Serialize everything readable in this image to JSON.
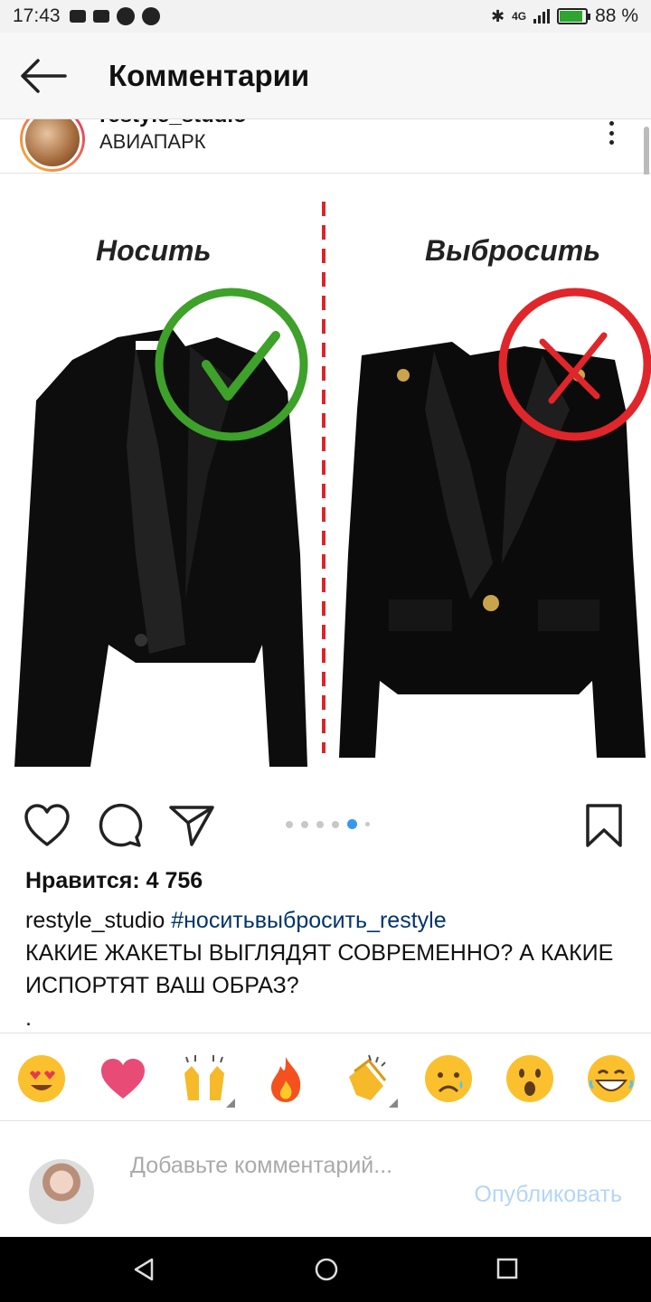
{
  "status_bar": {
    "time": "17:43",
    "network": "4G",
    "battery_percent": 88,
    "battery_label": "88 %"
  },
  "header": {
    "title": "Комментарии",
    "back_icon": "arrow-left-icon"
  },
  "post": {
    "username": "restyle_studio",
    "location": "АВИАПАРК",
    "image": {
      "left_label": "Носить",
      "right_label": "Выбросить"
    },
    "carousel": {
      "total": 6,
      "active_index": 4
    },
    "likes": "Нравится: 4 756",
    "caption_user": "restyle_studio",
    "caption_tag": "#носитьвыбросить_restyle",
    "caption_text": "КАКИЕ ЖАКЕТЫ ВЫГЛЯДЯТ СОВРЕМЕННО? А КАКИЕ ИСПОРТЯТ ВАШ ОБРАЗ?",
    "caption_dot": "."
  },
  "emoji_bar": {
    "items": [
      "heart-eyes",
      "heart",
      "raised-hands",
      "fire",
      "clapping-hands",
      "crying-face",
      "surprised-face",
      "laughing-face"
    ]
  },
  "composer": {
    "placeholder": "Добавьте комментарий...",
    "publish_label": "Опубликовать"
  },
  "colors": {
    "link": "#003569",
    "accent": "#3897f0",
    "publish_disabled": "#b3d6f8",
    "check_green": "#3ea12a",
    "cross_red": "#e0262a"
  }
}
